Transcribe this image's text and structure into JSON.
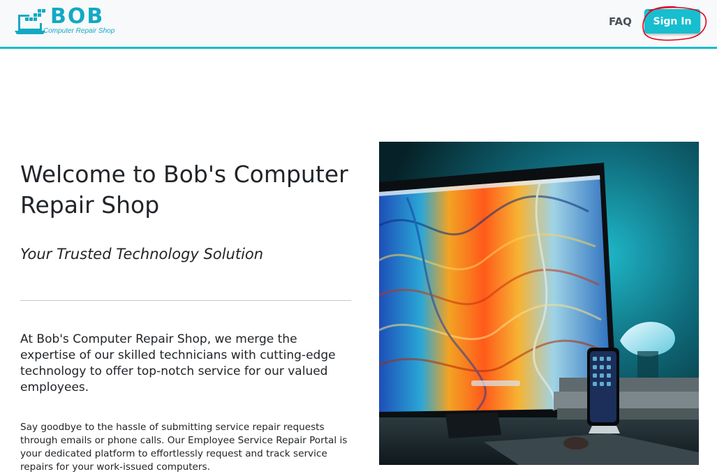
{
  "header": {
    "logo": {
      "title": "BOB",
      "subtitle": "Computer Repair Shop"
    },
    "nav": {
      "faq_label": "FAQ",
      "signin_label": "Sign In"
    }
  },
  "hero": {
    "title": "Welcome to Bob's Computer Repair Shop",
    "subtitle": "Your Trusted Technology Solution",
    "lead": "At Bob's Computer Repair Shop, we merge the expertise of our skilled technicians with cutting-edge technology to offer top-notch service for our valued employees.",
    "body": "Say goodbye to the hassle of submitting service repair requests through emails or phone calls. Our Employee Service Repair Portal is your dedicated platform to effortlessly request and track service repairs for your work-issued computers."
  },
  "image": {
    "icon": "computer-monitor-with-phone-photo"
  },
  "colors": {
    "accent": "#17becf",
    "brand": "#12a9c4",
    "header_bg": "#f8f9fa",
    "annotation": "#e3001b"
  }
}
